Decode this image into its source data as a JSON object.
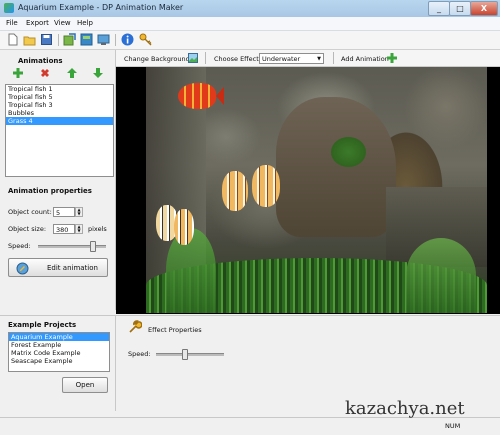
{
  "window": {
    "title": "Aquarium Example - DP Animation Maker",
    "minimize": "_",
    "maximize": "□",
    "close": "X"
  },
  "menu": {
    "items": [
      "File",
      "Export",
      "View",
      "Help"
    ]
  },
  "toolbar": {
    "icons": [
      "new-file-icon",
      "open-folder-icon",
      "save-icon",
      "export-icon",
      "export-html-icon",
      "export-screensaver-icon",
      "info-icon",
      "key-icon"
    ]
  },
  "animations_panel": {
    "title": "Animations",
    "items": [
      "Tropical fish 1",
      "Tropical fish 5",
      "Tropical fish 3",
      "Bubbles",
      "Grass 4"
    ],
    "selected_index": 4
  },
  "animation_properties": {
    "title": "Animation properties",
    "object_count_label": "Object count:",
    "object_count_value": "5",
    "object_size_label": "Object size:",
    "object_size_value": "380",
    "object_size_unit": "pixels",
    "speed_label": "Speed:",
    "speed_level": 0.82,
    "edit_button": "Edit animation"
  },
  "header": {
    "change_background": "Change Background",
    "choose_effect_label": "Choose Effect:",
    "effect_value": "Underwater",
    "add_animation": "Add Animation"
  },
  "example_projects": {
    "title": "Example Projects",
    "items": [
      "Aquarium Example",
      "Forest Example",
      "Matrix Code Example",
      "Seascape Example"
    ],
    "selected_index": 0,
    "open_button": "Open"
  },
  "effect_properties": {
    "title": "Effect Properties",
    "speed_label": "Speed:",
    "speed_level": 0.4
  },
  "statusbar": {
    "num": "NUM"
  },
  "watermark": "kazachya.net",
  "colors": {
    "selection": "#3399ff",
    "add_green": "#3aa53a",
    "delete_red": "#d33b2f",
    "info_blue": "#2a6fd6"
  }
}
